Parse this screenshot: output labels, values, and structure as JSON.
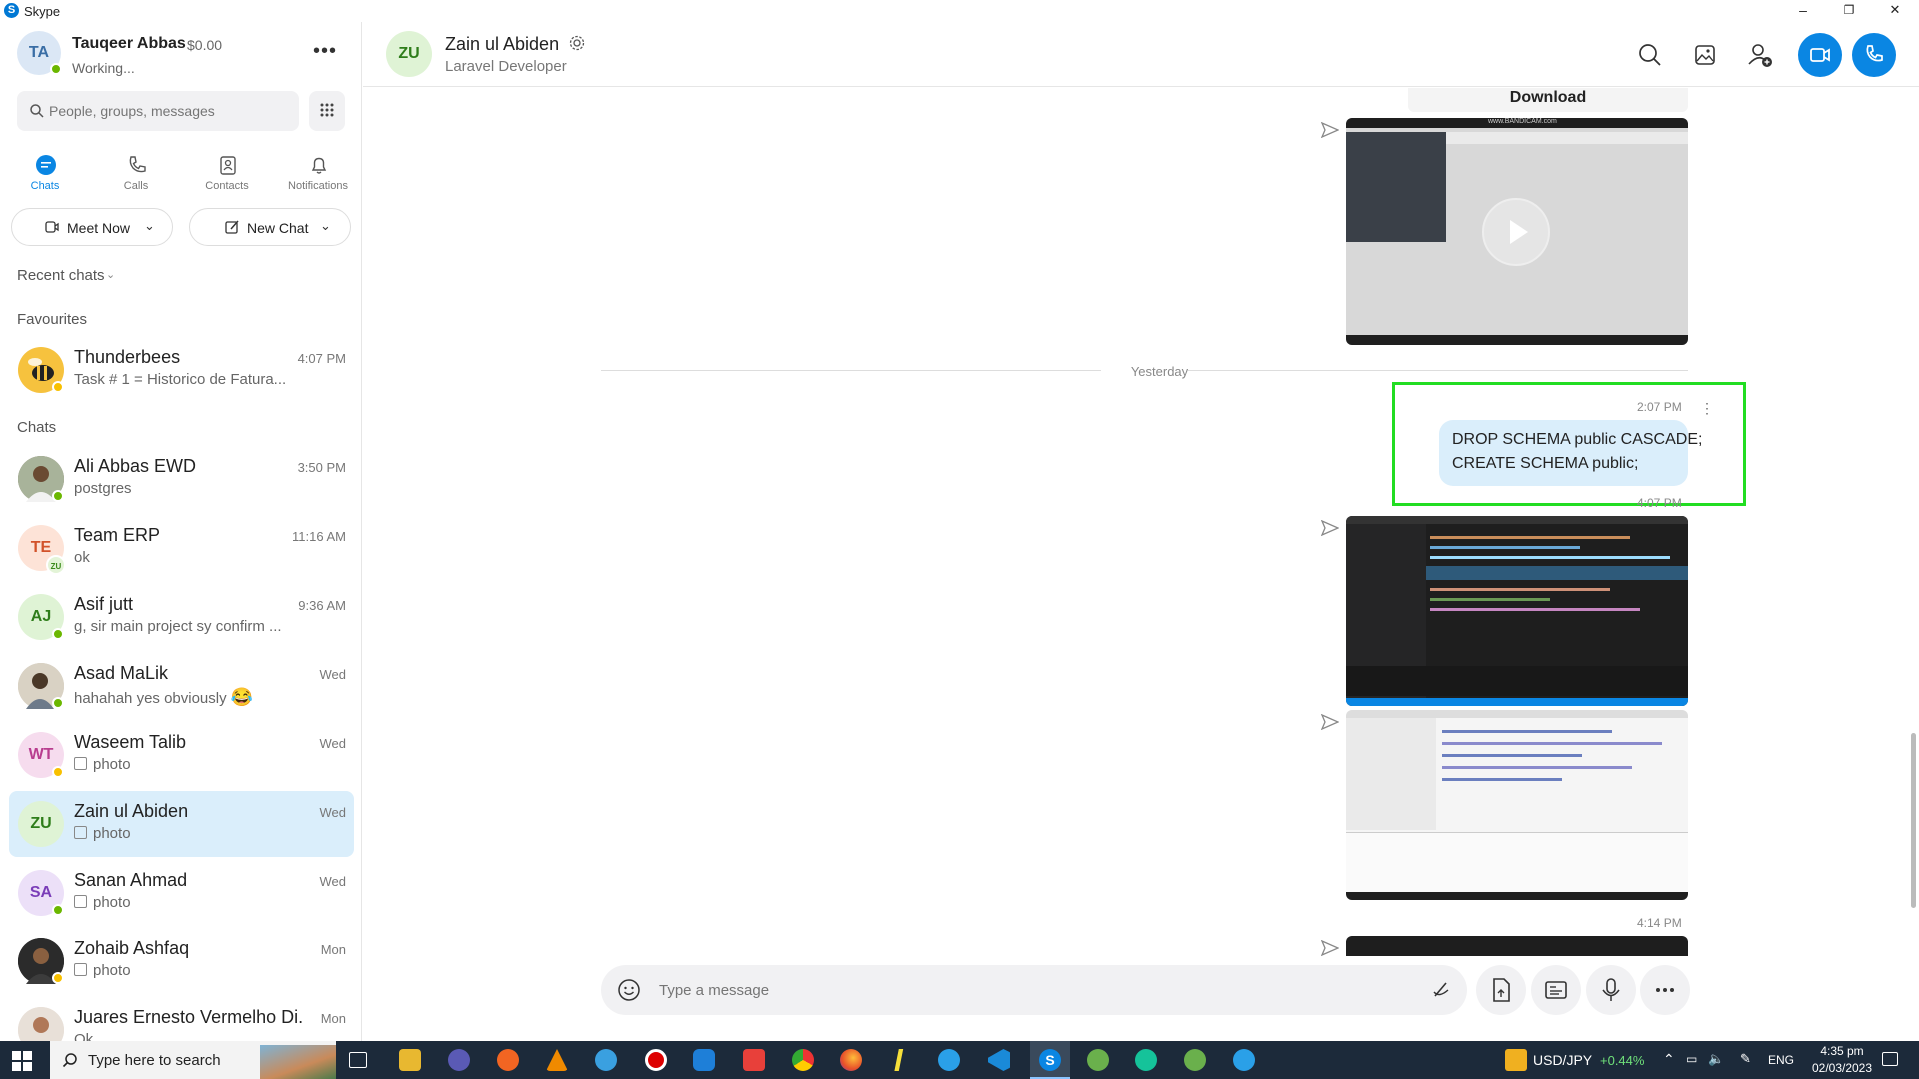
{
  "window": {
    "app_title": "Skype",
    "minimize": "–",
    "restore": "❐",
    "close": "✕"
  },
  "profile": {
    "initials": "TA",
    "name": "Tauqeer Abbas",
    "credit": "$0.00",
    "status": "Working...",
    "more": "•••"
  },
  "search": {
    "placeholder": "People, groups, messages"
  },
  "nav": {
    "chats": "Chats",
    "calls": "Calls",
    "contacts": "Contacts",
    "notifications": "Notifications"
  },
  "actions": {
    "meet_now": "Meet Now",
    "new_chat": "New Chat"
  },
  "sections": {
    "recent": "Recent chats",
    "favourites": "Favourites",
    "chats": "Chats"
  },
  "favourites": [
    {
      "name": "Thunderbees",
      "preview": "Task # 1 = Historico de Fatura...",
      "time": "4:07 PM"
    }
  ],
  "chats": [
    {
      "name": "Ali Abbas EWD",
      "preview": "postgres",
      "time": "3:50 PM"
    },
    {
      "name": "Team ERP",
      "initials": "TE",
      "badge": "ZU",
      "preview": "ok",
      "time": "11:16 AM"
    },
    {
      "name": "Asif jutt",
      "initials": "AJ",
      "preview": "g, sir main project sy confirm ...",
      "time": "9:36 AM"
    },
    {
      "name": "Asad MaLik",
      "preview": "hahahah yes obviously",
      "emoji": "😂",
      "time": "Wed"
    },
    {
      "name": "Waseem Talib",
      "initials": "WT",
      "preview": "photo",
      "time": "Wed"
    },
    {
      "name": "Zain ul Abiden",
      "initials": "ZU",
      "preview": "photo",
      "time": "Wed"
    },
    {
      "name": "Sanan Ahmad",
      "initials": "SA",
      "preview": "photo",
      "time": "Wed"
    },
    {
      "name": "Zohaib Ashfaq",
      "preview": "photo",
      "time": "Mon"
    },
    {
      "name": "Juares Ernesto Vermelho Di...",
      "preview": "Ok",
      "time": "Mon"
    }
  ],
  "conversation": {
    "initials": "ZU",
    "title": "Zain ul Abiden",
    "subtitle": "Laravel Developer",
    "download_label": "Download",
    "divider": "Yesterday",
    "message_time": "2:07 PM",
    "message_line1": "DROP SCHEMA public CASCADE;",
    "message_line2": "CREATE SCHEMA public;",
    "msg_menu": "⋮",
    "time_407": "4:07 PM",
    "time_414": "4:14 PM",
    "watermark": "www.BANDICAM.com"
  },
  "composer": {
    "placeholder": "Type a message"
  },
  "taskbar": {
    "search_placeholder": "Type here to search",
    "ticker": "USD/JPY",
    "ticker_change": "+0.44%",
    "lang": "ENG",
    "time": "4:35 pm",
    "date": "02/03/2023"
  },
  "colors": {
    "accent": "#0a86e3",
    "highlight_box": "#22dd22",
    "active_row": "#daeefb",
    "bubble": "#daeefb"
  }
}
